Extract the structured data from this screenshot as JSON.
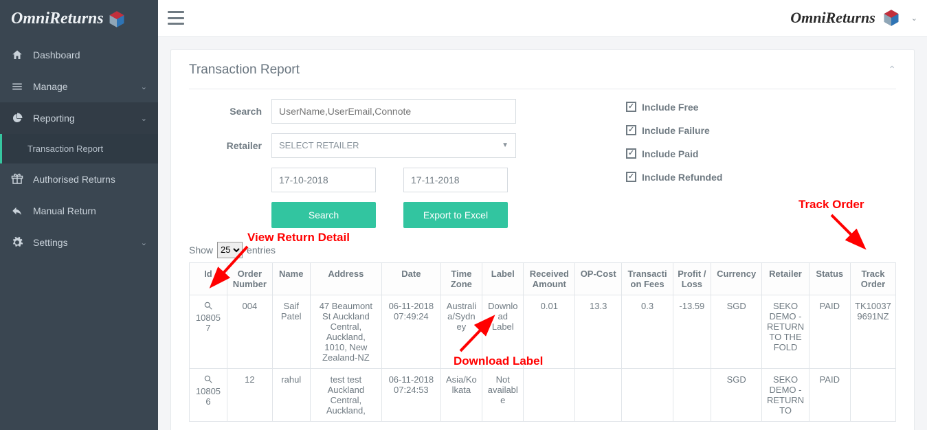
{
  "brand": "OmniReturns",
  "sidebar": {
    "items": [
      {
        "label": "Dashboard"
      },
      {
        "label": "Manage"
      },
      {
        "label": "Reporting"
      },
      {
        "label": "Transaction Report"
      },
      {
        "label": "Authorised Returns"
      },
      {
        "label": "Manual Return"
      },
      {
        "label": "Settings"
      }
    ]
  },
  "page": {
    "title": "Transaction Report",
    "search_label": "Search",
    "search_placeholder": "UserName,UserEmail,Connote",
    "retailer_label": "Retailer",
    "retailer_selected": "SELECT RETAILER",
    "date_from": "17-10-2018",
    "date_to": "17-11-2018",
    "search_btn": "Search",
    "export_btn": "Export to Excel",
    "checks": {
      "free": "Include Free",
      "failure": "Include Failure",
      "paid": "Include Paid",
      "refunded": "Include Refunded"
    },
    "show_prefix": "Show",
    "show_value": "25",
    "show_suffix": "entries",
    "columns": [
      "Id",
      "Order Number",
      "Name",
      "Address",
      "Date",
      "Time Zone",
      "Label",
      "Received Amount",
      "OP-Cost",
      "Transaction Fees",
      "Profit / Loss",
      "Currency",
      "Retailer",
      "Status",
      "Track Order"
    ],
    "rows": [
      {
        "id": "108057",
        "order": "004",
        "name": "Saif Patel",
        "address": "47 Beaumont St Auckland Central, Auckland, 1010, New Zealand-NZ",
        "date": "06-11-2018 07:49:24",
        "tz": "Australia/Sydney",
        "label": "Download Label",
        "received": "0.01",
        "opcost": "13.3",
        "tfees": "0.3",
        "pl": "-13.59",
        "currency": "SGD",
        "retailer": "SEKO DEMO - RETURN TO THE FOLD",
        "status": "PAID",
        "track": "TK100379691NZ"
      },
      {
        "id": "108056",
        "order": "12",
        "name": "rahul",
        "address": "test test Auckland Central, Auckland,",
        "date": "06-11-2018 07:24:53",
        "tz": "Asia/Kolkata",
        "label": "Not available",
        "received": "",
        "opcost": "",
        "tfees": "",
        "pl": "",
        "currency": "SGD",
        "retailer": "SEKO DEMO - RETURN TO",
        "status": "PAID",
        "track": ""
      }
    ]
  },
  "annotations": {
    "view_return": "View Return Detail",
    "download_label": "Download Label",
    "track_order": "Track Order"
  }
}
